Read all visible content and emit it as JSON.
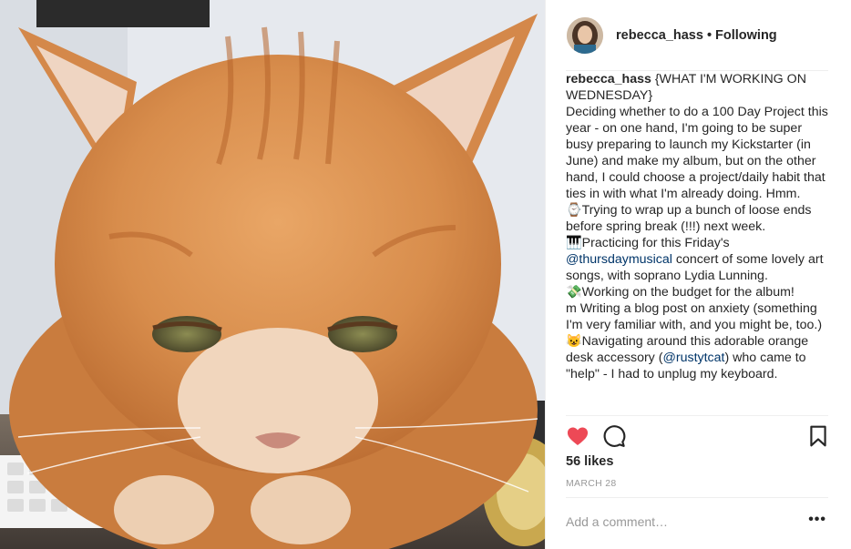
{
  "post": {
    "image": {
      "subject": "orange-tabby-cat-photo"
    },
    "header": {
      "avatar_icon": "user-avatar",
      "username": "rebecca_hass",
      "separator": "•",
      "follow_status": "Following"
    },
    "caption": {
      "username": "rebecca_hass",
      "lines": [
        {
          "text": " {WHAT I'M WORKING ON WEDNESDAY}\n"
        },
        {
          "text": "Deciding whether to do a 100 Day Project this year - on one hand, I'm going to be super busy preparing to launch my Kickstarter (in June) and make my album, but on the other hand, I could choose a project/daily habit that ties in with what I'm already doing. Hmm.\n"
        },
        {
          "text": "⌚Trying to wrap up a bunch of loose ends before spring break (!!!) next week.\n"
        },
        {
          "text": "🎹Practicing for this Friday's "
        },
        {
          "text": "@thursdaymusical",
          "mention": true
        },
        {
          "text": " concert of some lovely art songs, with soprano Lydia Lunning.\n"
        },
        {
          "text": "💸Working on the budget for the album!\n"
        },
        {
          "text": "m Writing a blog post on anxiety (something I'm very familiar with, and you might be, too.)\n"
        },
        {
          "text": "😺Navigating around this adorable orange desk accessory ("
        },
        {
          "text": "@rustytcat",
          "mention": true
        },
        {
          "text": ") who came to \"help\" - I had to unplug my keyboard."
        }
      ]
    },
    "actions": {
      "like_icon": "heart-icon",
      "comment_icon": "comment-icon",
      "save_icon": "bookmark-icon",
      "liked": true,
      "like_color": "#ed4956"
    },
    "likes_text": "56 likes",
    "date": "MARCH 28",
    "comment_box": {
      "placeholder": "Add a comment…",
      "value": "",
      "more_label": "•••"
    }
  }
}
